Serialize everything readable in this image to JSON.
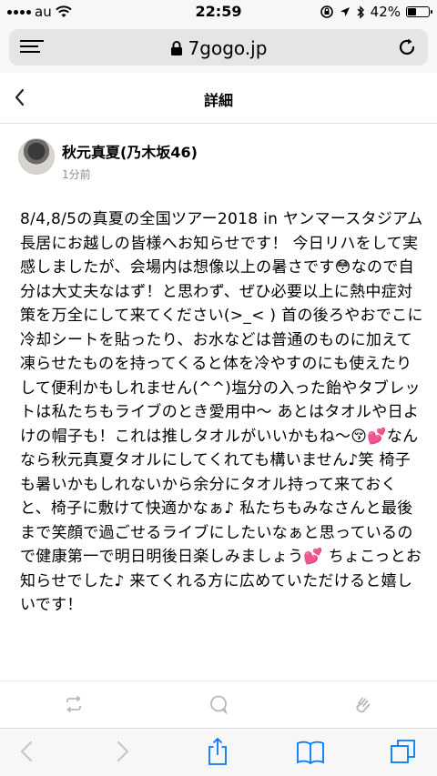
{
  "status_bar": {
    "carrier": "au",
    "time": "22:59",
    "battery_percent": "42%",
    "battery_level": 0.42
  },
  "address_bar": {
    "url": "7gogo.jp"
  },
  "nav": {
    "title": "詳細"
  },
  "post": {
    "author": "秋元真夏(乃木坂46)",
    "time": "1分前",
    "body": "8/4,8/5の真夏の全国ツアー2018 in ヤンマースタジアム長居にお越しの皆様へお知らせです！ 今日リハをして実感しましたが、会場内は想像以上の暑さです😳なので自分は大丈夫なはず！と思わず、ぜひ必要以上に熱中症対策を万全にして来てください(>_< ) 首の後ろやおでこに冷却シートを貼ったり、お水などは普通のものに加えて凍らせたものを持ってくると体を冷やすのにも使えたりして便利かもしれません(^^)塩分の入った飴やタブレットは私たちもライブのとき愛用中〜 あとはタオルや日よけの帽子も！これは推しタオルがいいかもね〜😚💕なんなら秋元真夏タオルにしてくれても構いません♪笑 椅子も暑いかもしれないから余分にタオル持って来ておくと、椅子に敷けて快適かなぁ♪ 私たちもみなさんと最後まで笑顔で過ごせるライブにしたいなぁと思っているので健康第一で明日明後日楽しみましょう💕 ちょこっとお知らせでした♪ 来てくれる方に広めていただけると嬉しいです！"
  },
  "icons": {
    "signal": "signal-dots-icon",
    "wifi": "wifi-icon",
    "rotation_lock": "rotation-lock-icon",
    "location": "location-arrow-icon",
    "bluetooth": "bluetooth-icon",
    "battery": "battery-icon",
    "menu": "reader-menu-icon",
    "lock": "lock-icon",
    "reload": "reload-icon",
    "back": "chevron-left-icon",
    "repost": "repost-icon",
    "comment": "comment-icon",
    "clap": "clap-icon",
    "safari_back": "safari-back-icon",
    "safari_forward": "safari-forward-icon",
    "share": "share-icon",
    "bookmarks": "bookmarks-icon",
    "tabs": "tabs-icon"
  },
  "colors": {
    "accent": "#007aff",
    "muted_icon": "#b8b8bd",
    "bar_bg": "#f7f7f7"
  }
}
